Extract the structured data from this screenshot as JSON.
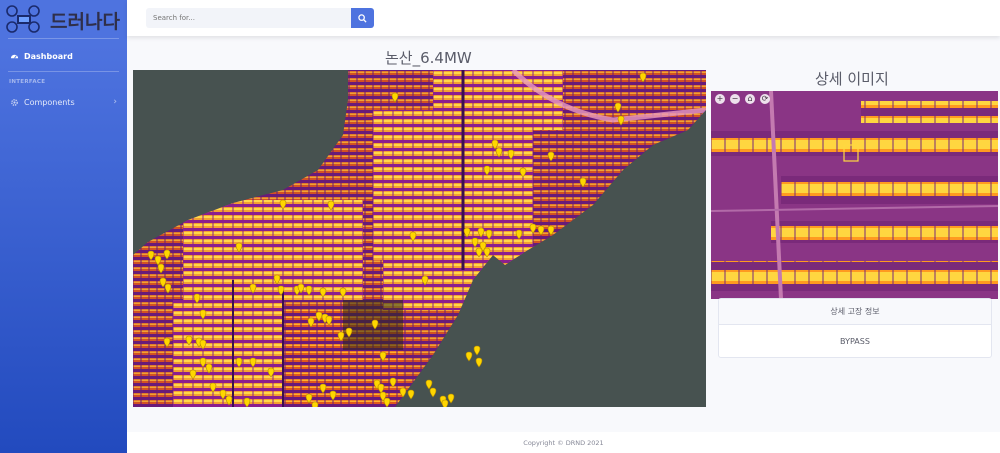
{
  "brand": {
    "name": "드러나다"
  },
  "sidebar": {
    "items": [
      {
        "label": "Dashboard",
        "icon": "dashboard-icon"
      },
      {
        "label": "Components",
        "icon": "gear-icon"
      }
    ],
    "heading": "INTERFACE"
  },
  "search": {
    "placeholder": "Search for...",
    "icon": "search-icon"
  },
  "map": {
    "title": "논산_6.4MW",
    "marker_icon": "map-pin-icon"
  },
  "detail": {
    "title": "상세 이미지",
    "zoom_tools": [
      "+",
      "−",
      "⌂",
      "⟳"
    ],
    "info_header": "상세 고장 정보",
    "info_value": "BYPASS"
  },
  "footer": {
    "copyright": "Copyright © DRND 2021"
  },
  "colors": {
    "sidebar_top": "#4e73df",
    "sidebar_bottom": "#224abe",
    "marker": "#ffd600"
  }
}
